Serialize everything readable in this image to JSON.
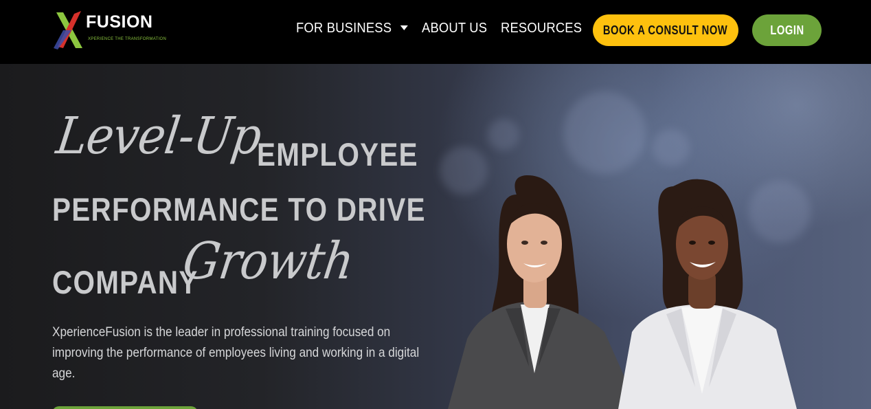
{
  "header": {
    "logo": {
      "wordmark": "FUSION",
      "tagline": "XPERIENCE THE TRANSFORMATION",
      "icon": "x-logo-icon"
    },
    "nav": [
      {
        "label": "FOR BUSINESS",
        "icon": "chevron-down-icon"
      },
      {
        "label": "ABOUT US"
      },
      {
        "label": "RESOURCES"
      }
    ],
    "consult_button": "BOOK A CONSULT NOW",
    "login_button": "LOGIN"
  },
  "hero": {
    "script_1": "Level-Up",
    "line_1": "EMPLOYEE",
    "line_2": "PERFORMANCE TO DRIVE",
    "line_3": "COMPANY",
    "script_2": "Growth",
    "description": "XperienceFusion is the leader in professional training focused on improving the performance of employees living and working in a digital age."
  },
  "colors": {
    "header_bg": "#000000",
    "consult_bg": "#fec10e",
    "login_bg": "#6ca33a",
    "headline": "#c9cacc"
  }
}
